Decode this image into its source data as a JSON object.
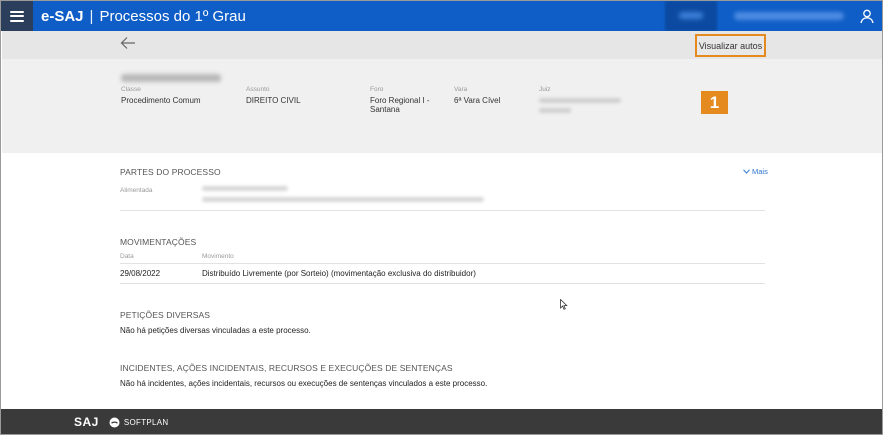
{
  "header": {
    "app_name": "e-SAJ",
    "separator": "|",
    "module_name": "Processos do 1º Grau"
  },
  "toolbar": {
    "view_button_label": "Visualizar autos",
    "step_badge": "1"
  },
  "process": {
    "fields": [
      {
        "label": "Classe",
        "value": "Procedimento Comum"
      },
      {
        "label": "Assunto",
        "value": "DIREITO CIVIL"
      },
      {
        "label": "Foro",
        "value": "Foro Regional I - Santana"
      },
      {
        "label": "Vara",
        "value": "6ª Vara Cível"
      },
      {
        "label": "Juiz",
        "value": ""
      }
    ],
    "more_label": "Mais"
  },
  "parties": {
    "title": "PARTES DO PROCESSO",
    "role_label": "Alimentada"
  },
  "movements": {
    "title": "MOVIMENTAÇÕES",
    "col_date": "Data",
    "col_movement": "Movimento",
    "rows": [
      {
        "date": "29/08/2022",
        "movement": "Distribuído Livremente (por Sorteio) (movimentação exclusiva do distribuidor)"
      }
    ]
  },
  "petitions": {
    "title": "PETIÇÕES DIVERSAS",
    "empty_text": "Não há petições diversas vinculadas a este processo."
  },
  "incidents": {
    "title": "INCIDENTES, AÇÕES INCIDENTAIS, RECURSOS E EXECUÇÕES DE SENTENÇAS",
    "empty_text": "Não há incidentes, ações incidentais, recursos ou execuções de sentenças vinculados a este processo."
  },
  "footer": {
    "saj_logo": "SAJ",
    "softplan_logo": "SOFTPLAN"
  },
  "colors": {
    "header_blue": "#0f5ec7",
    "menu_dark": "#2b3f5c",
    "highlight_orange": "#e58a1f",
    "footer_dark": "#3a3a3a",
    "link_blue": "#2f74cf"
  }
}
